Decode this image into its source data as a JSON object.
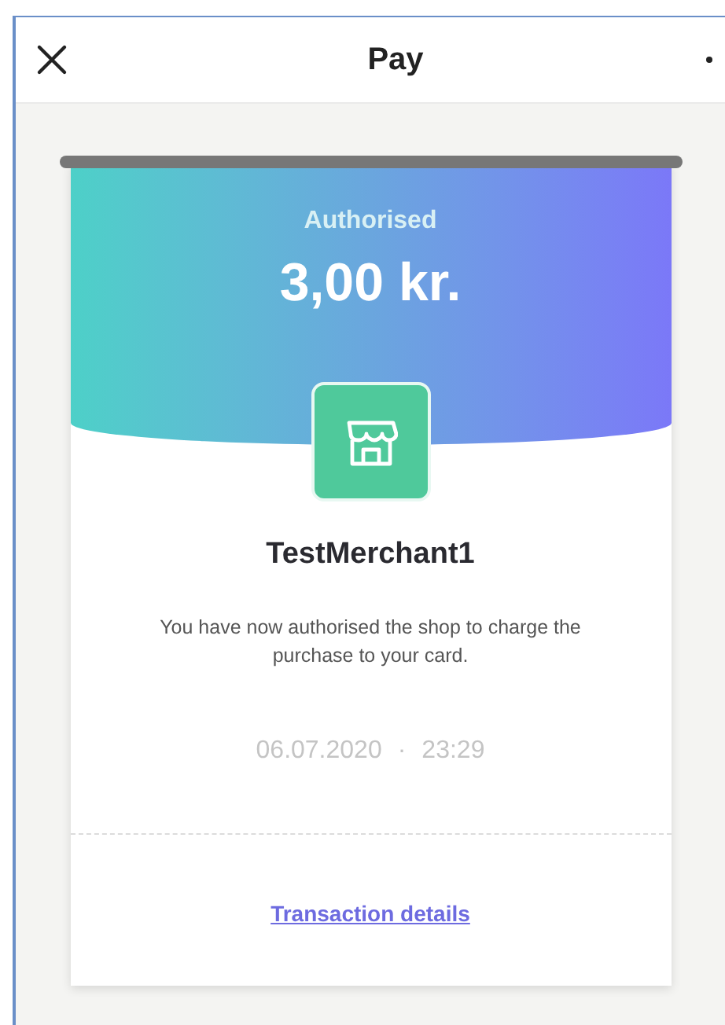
{
  "header": {
    "title": "Pay"
  },
  "receipt": {
    "status": "Authorised",
    "amount": "3,00 kr.",
    "merchant": "TestMerchant1",
    "message": "You have now authorised the shop to charge the purchase to your card.",
    "date": "06.07.2020",
    "separator": "·",
    "time": "23:29",
    "link": "Transaction details"
  }
}
